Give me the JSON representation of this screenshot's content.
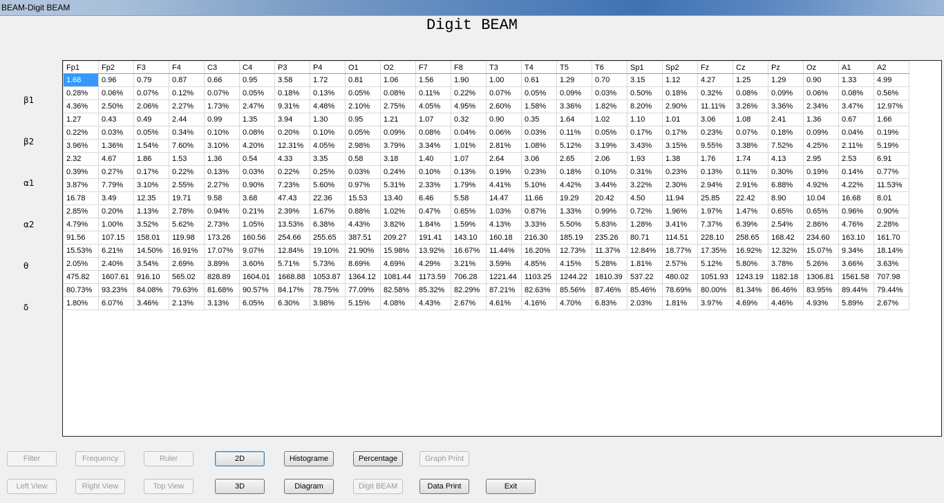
{
  "window": {
    "title": "BEAM-Digit BEAM"
  },
  "page_title": "Digit BEAM",
  "columns": [
    "Fp1",
    "Fp2",
    "F3",
    "F4",
    "C3",
    "C4",
    "P3",
    "P4",
    "O1",
    "O2",
    "F7",
    "F8",
    "T3",
    "T4",
    "T5",
    "T6",
    "Sp1",
    "Sp2",
    "Fz",
    "Cz",
    "Pz",
    "Oz",
    "A1",
    "A2"
  ],
  "bands": [
    {
      "label": "β1",
      "rows": [
        [
          "1.68",
          "0.96",
          "0.79",
          "0.87",
          "0.66",
          "0.95",
          "3.58",
          "1.72",
          "0.81",
          "1.06",
          "1.56",
          "1.90",
          "1.00",
          "0.61",
          "1.29",
          "0.70",
          "3.15",
          "1.12",
          "4.27",
          "1.25",
          "1.29",
          "0.90",
          "1.33",
          "4.99"
        ],
        [
          "0.28%",
          "0.06%",
          "0.07%",
          "0.12%",
          "0.07%",
          "0.05%",
          "0.18%",
          "0.13%",
          "0.05%",
          "0.08%",
          "0.11%",
          "0.22%",
          "0.07%",
          "0.05%",
          "0.09%",
          "0.03%",
          "0.50%",
          "0.18%",
          "0.32%",
          "0.08%",
          "0.09%",
          "0.06%",
          "0.08%",
          "0.56%"
        ],
        [
          "4.36%",
          "2.50%",
          "2.06%",
          "2.27%",
          "1.73%",
          "2.47%",
          "9.31%",
          "4.48%",
          "2.10%",
          "2.75%",
          "4.05%",
          "4.95%",
          "2.60%",
          "1.58%",
          "3.36%",
          "1.82%",
          "8.20%",
          "2.90%",
          "11.11%",
          "3.26%",
          "3.36%",
          "2.34%",
          "3.47%",
          "12.97%"
        ]
      ]
    },
    {
      "label": "β2",
      "rows": [
        [
          "1.27",
          "0.43",
          "0.49",
          "2.44",
          "0.99",
          "1.35",
          "3.94",
          "1.30",
          "0.95",
          "1.21",
          "1.07",
          "0.32",
          "0.90",
          "0.35",
          "1.64",
          "1.02",
          "1.10",
          "1.01",
          "3.06",
          "1.08",
          "2.41",
          "1.36",
          "0.67",
          "1.66"
        ],
        [
          "0.22%",
          "0.03%",
          "0.05%",
          "0.34%",
          "0.10%",
          "0.08%",
          "0.20%",
          "0.10%",
          "0.05%",
          "0.09%",
          "0.08%",
          "0.04%",
          "0.06%",
          "0.03%",
          "0.11%",
          "0.05%",
          "0.17%",
          "0.17%",
          "0.23%",
          "0.07%",
          "0.18%",
          "0.09%",
          "0.04%",
          "0.19%"
        ],
        [
          "3.96%",
          "1.36%",
          "1.54%",
          "7.60%",
          "3.10%",
          "4.20%",
          "12.31%",
          "4.05%",
          "2.98%",
          "3.79%",
          "3.34%",
          "1.01%",
          "2.81%",
          "1.08%",
          "5.12%",
          "3.19%",
          "3.43%",
          "3.15%",
          "9.55%",
          "3.38%",
          "7.52%",
          "4.25%",
          "2.11%",
          "5.19%"
        ]
      ]
    },
    {
      "label": "α1",
      "rows": [
        [
          "2.32",
          "4.67",
          "1.86",
          "1.53",
          "1.36",
          "0.54",
          "4.33",
          "3.35",
          "0.58",
          "3.18",
          "1.40",
          "1.07",
          "2.64",
          "3.06",
          "2.65",
          "2.06",
          "1.93",
          "1.38",
          "1.76",
          "1.74",
          "4.13",
          "2.95",
          "2.53",
          "6.91"
        ],
        [
          "0.39%",
          "0.27%",
          "0.17%",
          "0.22%",
          "0.13%",
          "0.03%",
          "0.22%",
          "0.25%",
          "0.03%",
          "0.24%",
          "0.10%",
          "0.13%",
          "0.19%",
          "0.23%",
          "0.18%",
          "0.10%",
          "0.31%",
          "0.23%",
          "0.13%",
          "0.11%",
          "0.30%",
          "0.19%",
          "0.14%",
          "0.77%"
        ],
        [
          "3.87%",
          "7.79%",
          "3.10%",
          "2.55%",
          "2.27%",
          "0.90%",
          "7.23%",
          "5.60%",
          "0.97%",
          "5.31%",
          "2.33%",
          "1.79%",
          "4.41%",
          "5.10%",
          "4.42%",
          "3.44%",
          "3.22%",
          "2.30%",
          "2.94%",
          "2.91%",
          "6.88%",
          "4.92%",
          "4.22%",
          "11.53%"
        ]
      ]
    },
    {
      "label": "α2",
      "rows": [
        [
          "16.78",
          "3.49",
          "12.35",
          "19.71",
          "9.58",
          "3.68",
          "47.43",
          "22.36",
          "15.53",
          "13.40",
          "6.46",
          "5.58",
          "14.47",
          "11.66",
          "19.29",
          "20.42",
          "4.50",
          "11.94",
          "25.85",
          "22.42",
          "8.90",
          "10.04",
          "16.68",
          "8.01"
        ],
        [
          "2.85%",
          "0.20%",
          "1.13%",
          "2.78%",
          "0.94%",
          "0.21%",
          "2.39%",
          "1.67%",
          "0.88%",
          "1.02%",
          "0.47%",
          "0.65%",
          "1.03%",
          "0.87%",
          "1.33%",
          "0.99%",
          "0.72%",
          "1.96%",
          "1.97%",
          "1.47%",
          "0.65%",
          "0.65%",
          "0.96%",
          "0.90%"
        ],
        [
          "4.79%",
          "1.00%",
          "3.52%",
          "5.62%",
          "2.73%",
          "1.05%",
          "13.53%",
          "6.38%",
          "4.43%",
          "3.82%",
          "1.84%",
          "1.59%",
          "4.13%",
          "3.33%",
          "5.50%",
          "5.83%",
          "1.28%",
          "3.41%",
          "7.37%",
          "6.39%",
          "2.54%",
          "2.86%",
          "4.76%",
          "2.28%"
        ]
      ]
    },
    {
      "label": "θ",
      "rows": [
        [
          "91.56",
          "107.15",
          "158.01",
          "119.98",
          "173.26",
          "160.56",
          "254.66",
          "255.65",
          "387.51",
          "209.27",
          "191.41",
          "143.10",
          "160.18",
          "216.30",
          "185.19",
          "235.26",
          "80.71",
          "114.51",
          "228.10",
          "258.65",
          "168.42",
          "234.60",
          "163.10",
          "161.70"
        ],
        [
          "15.53%",
          "6.21%",
          "14.50%",
          "16.91%",
          "17.07%",
          "9.07%",
          "12.84%",
          "19.10%",
          "21.90%",
          "15.98%",
          "13.92%",
          "16.67%",
          "11.44%",
          "16.20%",
          "12.73%",
          "11.37%",
          "12.84%",
          "18.77%",
          "17.35%",
          "16.92%",
          "12.32%",
          "15.07%",
          "9.34%",
          "18.14%"
        ],
        [
          "2.05%",
          "2.40%",
          "3.54%",
          "2.69%",
          "3.89%",
          "3.60%",
          "5.71%",
          "5.73%",
          "8.69%",
          "4.69%",
          "4.29%",
          "3.21%",
          "3.59%",
          "4.85%",
          "4.15%",
          "5.28%",
          "1.81%",
          "2.57%",
          "5.12%",
          "5.80%",
          "3.78%",
          "5.26%",
          "3.66%",
          "3.63%"
        ]
      ]
    },
    {
      "label": "δ",
      "rows": [
        [
          "475.82",
          "1607.61",
          "916.10",
          "565.02",
          "828.89",
          "1604.01",
          "1668.88",
          "1053.87",
          "1364.12",
          "1081.44",
          "1173.59",
          "706.28",
          "1221.44",
          "1103.25",
          "1244.22",
          "1810.39",
          "537.22",
          "480.02",
          "1051.93",
          "1243.19",
          "1182.18",
          "1306.81",
          "1561.58",
          "707.98"
        ],
        [
          "80.73%",
          "93.23%",
          "84.08%",
          "79.63%",
          "81.68%",
          "90.57%",
          "84.17%",
          "78.75%",
          "77.09%",
          "82.58%",
          "85.32%",
          "82.29%",
          "87.21%",
          "82.63%",
          "85.56%",
          "87.46%",
          "85.46%",
          "78.69%",
          "80.00%",
          "81.34%",
          "86.46%",
          "83.95%",
          "89.44%",
          "79.44%"
        ],
        [
          "1.80%",
          "6.07%",
          "3.46%",
          "2.13%",
          "3.13%",
          "6.05%",
          "6.30%",
          "3.98%",
          "5.15%",
          "4.08%",
          "4.43%",
          "2.67%",
          "4.61%",
          "4.16%",
          "4.70%",
          "6.83%",
          "2.03%",
          "1.81%",
          "3.97%",
          "4.69%",
          "4.46%",
          "4.93%",
          "5.89%",
          "2.67%"
        ]
      ]
    }
  ],
  "buttons": {
    "row1": [
      {
        "id": "filter",
        "label": "Filter",
        "enabled": false
      },
      {
        "id": "frequency",
        "label": "Frequency",
        "enabled": false
      },
      {
        "id": "ruler",
        "label": "Ruler",
        "enabled": false
      },
      {
        "id": "2d",
        "label": "2D",
        "enabled": true
      },
      {
        "id": "histograme",
        "label": "Histograme",
        "enabled": true
      },
      {
        "id": "percentage",
        "label": "Percentage",
        "enabled": true
      },
      {
        "id": "graph-print",
        "label": "Graph Print",
        "enabled": false
      }
    ],
    "row2": [
      {
        "id": "left-view",
        "label": "Left View",
        "enabled": false
      },
      {
        "id": "right-view",
        "label": "Right View",
        "enabled": false
      },
      {
        "id": "top-view",
        "label": "Top View",
        "enabled": false
      },
      {
        "id": "3d",
        "label": "3D",
        "enabled": true
      },
      {
        "id": "diagram",
        "label": "Diagram",
        "enabled": true
      },
      {
        "id": "digit-beam",
        "label": "Digit BEAM",
        "enabled": false
      },
      {
        "id": "data-print",
        "label": "Data Print",
        "enabled": true
      },
      {
        "id": "exit",
        "label": "Exit",
        "enabled": true
      }
    ]
  }
}
